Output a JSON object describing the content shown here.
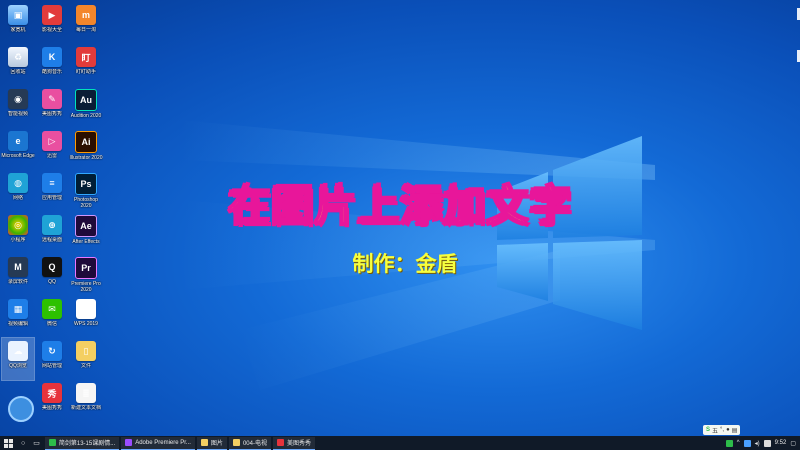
{
  "overlay": {
    "title": "在图片上添加文字",
    "subtitle": "制作：金盾"
  },
  "desktop_icons": [
    {
      "label": "家宽机",
      "glyph": "▣",
      "cls": "g-computer",
      "name": "this-pc-icon"
    },
    {
      "label": "影视大全",
      "glyph": "▶",
      "cls": "g-chrome-red",
      "name": "video-app-icon"
    },
    {
      "label": "每日一淘",
      "glyph": "m",
      "cls": "g-orange",
      "name": "taobao-icon"
    },
    {
      "label": "回收站",
      "glyph": "♻",
      "cls": "g-recycle",
      "name": "recycle-bin-icon"
    },
    {
      "label": "酷狗音乐",
      "glyph": "K",
      "cls": "g-blue",
      "name": "kugou-icon"
    },
    {
      "label": "盯盯助手",
      "glyph": "盯",
      "cls": "g-chrome-red",
      "name": "dingding-icon"
    },
    {
      "label": "智能视频",
      "glyph": "◉",
      "cls": "g-dark",
      "name": "camera-app-icon"
    },
    {
      "label": "美图秀秀",
      "glyph": "✎",
      "cls": "g-pink",
      "name": "meitu-icon"
    },
    {
      "label": "Audition 2020",
      "glyph": "Au",
      "cls": "g-au",
      "name": "audition-icon"
    },
    {
      "label": "Microsoft Edge",
      "glyph": "e",
      "cls": "g-edge",
      "name": "edge-icon"
    },
    {
      "label": "迅雷",
      "glyph": "▷",
      "cls": "g-pink",
      "name": "xunlei-icon"
    },
    {
      "label": "Illustrator 2020",
      "glyph": "Ai",
      "cls": "g-ai",
      "name": "illustrator-icon"
    },
    {
      "label": "网络",
      "glyph": "◍",
      "cls": "g-cyan",
      "name": "network-icon"
    },
    {
      "label": "应用管理",
      "glyph": "≡",
      "cls": "g-blue",
      "name": "app-manager-icon"
    },
    {
      "label": "Photoshop 2020",
      "glyph": "Ps",
      "cls": "g-ps",
      "name": "photoshop-icon"
    },
    {
      "label": "小程序",
      "glyph": "◎",
      "cls": "g-ring",
      "name": "miniapp-icon"
    },
    {
      "label": "远程桌面",
      "glyph": "⊕",
      "cls": "g-cyan",
      "name": "remote-desktop-icon"
    },
    {
      "label": "After Effects",
      "glyph": "Ae",
      "cls": "g-ae",
      "name": "after-effects-icon"
    },
    {
      "label": "录屏软件",
      "glyph": "M",
      "cls": "g-dark",
      "name": "screen-recorder-icon"
    },
    {
      "label": "QQ",
      "glyph": "Q",
      "cls": "g-qq",
      "name": "qq-icon"
    },
    {
      "label": "Premiere Pro 2020",
      "glyph": "Pr",
      "cls": "g-pr",
      "name": "premiere-icon"
    },
    {
      "label": "视频编辑",
      "glyph": "▦",
      "cls": "g-blue",
      "name": "video-editor-icon"
    },
    {
      "label": "微信",
      "glyph": "✉",
      "cls": "g-wechat",
      "name": "wechat-icon"
    },
    {
      "label": "WPS 2019",
      "glyph": "W",
      "cls": "g-wps",
      "name": "wps-icon"
    },
    {
      "label": "QQ浏览",
      "glyph": "☁",
      "cls": "g-cloud",
      "name": "cloud-app-icon"
    },
    {
      "label": "网站管理",
      "glyph": "↻",
      "cls": "g-blue",
      "name": "web-manager-icon"
    },
    {
      "label": "文件",
      "glyph": "▯",
      "cls": "g-folder",
      "name": "folder-icon"
    },
    {
      "label": "",
      "glyph": "",
      "cls": "",
      "name": "empty-slot"
    },
    {
      "label": "美图秀秀",
      "glyph": "秀",
      "cls": "g-xiu",
      "name": "meitu-xiuxiu-icon"
    },
    {
      "label": "新建文本文档",
      "glyph": "≣",
      "cls": "g-file",
      "name": "text-document-icon"
    }
  ],
  "taskbar": {
    "tasks": [
      {
        "label": "简剑第13-15课剧情...",
        "color": "#2dbd4a"
      },
      {
        "label": "Adobe Premiere Pr...",
        "color": "#9a4dff"
      },
      {
        "label": "图片",
        "color": "#f4cf62"
      },
      {
        "label": "004-电视",
        "color": "#f4cf62"
      },
      {
        "label": "美图秀秀",
        "color": "#e7333c"
      }
    ],
    "clock": "9:52",
    "ime_char": "五"
  },
  "colors": {
    "title_fill": "#f7ff3d",
    "title_stroke": "#e8169a",
    "taskbar_bg": "#101a28"
  }
}
